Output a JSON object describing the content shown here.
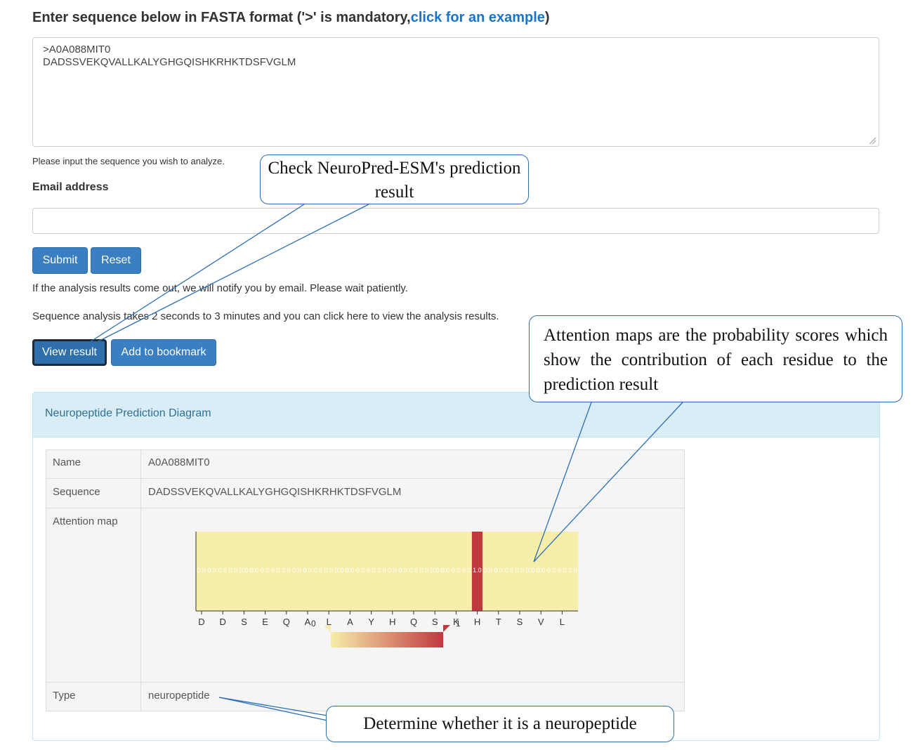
{
  "form": {
    "heading_prefix": "Enter sequence below in FASTA format ('>' is mandatory,",
    "heading_link": "click for an example",
    "heading_suffix": ")",
    "sequence_value": ">A0A088MIT0\nDADSSVEKQVALLKALYGHGQISHKRHKTDSFVGLM",
    "help_text": "Please input the sequence you wish to analyze.",
    "email_label": "Email address",
    "email_value": "",
    "submit_label": "Submit",
    "reset_label": "Reset",
    "notify_text": "If the analysis results come out, we will notify you by email. Please wait patiently.",
    "analysis_text": "Sequence analysis takes 2 seconds to 3 minutes and you can click here to view the analysis results.",
    "view_result_label": "View result",
    "bookmark_label": "Add to bookmark"
  },
  "panel": {
    "title": "Neuropeptide Prediction Diagram",
    "rows": {
      "name_label": "Name",
      "name_value": "A0A088MIT0",
      "sequence_label": "Sequence",
      "sequence_value": "DADSSVEKQVALLKALYGHGQISHKRHKTDSFVGLM",
      "attention_label": "Attention map",
      "type_label": "Type",
      "type_value": "neuropeptide"
    }
  },
  "heatmap": {
    "tick_labels": [
      "D",
      "D",
      "S",
      "E",
      "Q",
      "A",
      "L",
      "A",
      "Y",
      "H",
      "Q",
      "S",
      "K",
      "H",
      "T",
      "S",
      "V",
      "L"
    ],
    "cell_values": [
      0,
      0,
      0,
      0,
      0,
      0,
      0,
      0,
      0,
      0,
      0,
      0,
      0,
      0,
      0,
      0,
      0,
      0,
      0,
      0,
      0,
      0,
      0,
      0,
      0,
      0,
      1,
      0,
      0,
      0,
      0,
      0,
      0,
      0,
      0,
      0
    ],
    "cell_value_labels": [
      "0.0",
      "0.0",
      "0.0",
      "0.0",
      "0.0",
      "0.0",
      "0.0",
      "0.0",
      "0.0",
      "0.0",
      "0.0",
      "0.0",
      "0.0",
      "0.0",
      "0.0",
      "0.0",
      "0.0",
      "0.0",
      "0.0",
      "0.0",
      "0.0",
      "0.0",
      "0.0",
      "0.0",
      "0.0",
      "0.0",
      "1.0",
      "0.0",
      "0.0",
      "0.0",
      "0.0",
      "0.0",
      "0.0",
      "0.0",
      "0.0",
      "0.0"
    ],
    "legend_min": "0",
    "legend_max": "1",
    "low_color": "#f6eeaa",
    "high_color": "#c0393f"
  },
  "annotations": {
    "check_result": "Check NeuroPred-ESM's prediction result",
    "attention_explain": "Attention maps are the probability scores which show the contribution of each residue to the prediction result",
    "determine": "Determine whether it is a neuropeptide"
  }
}
